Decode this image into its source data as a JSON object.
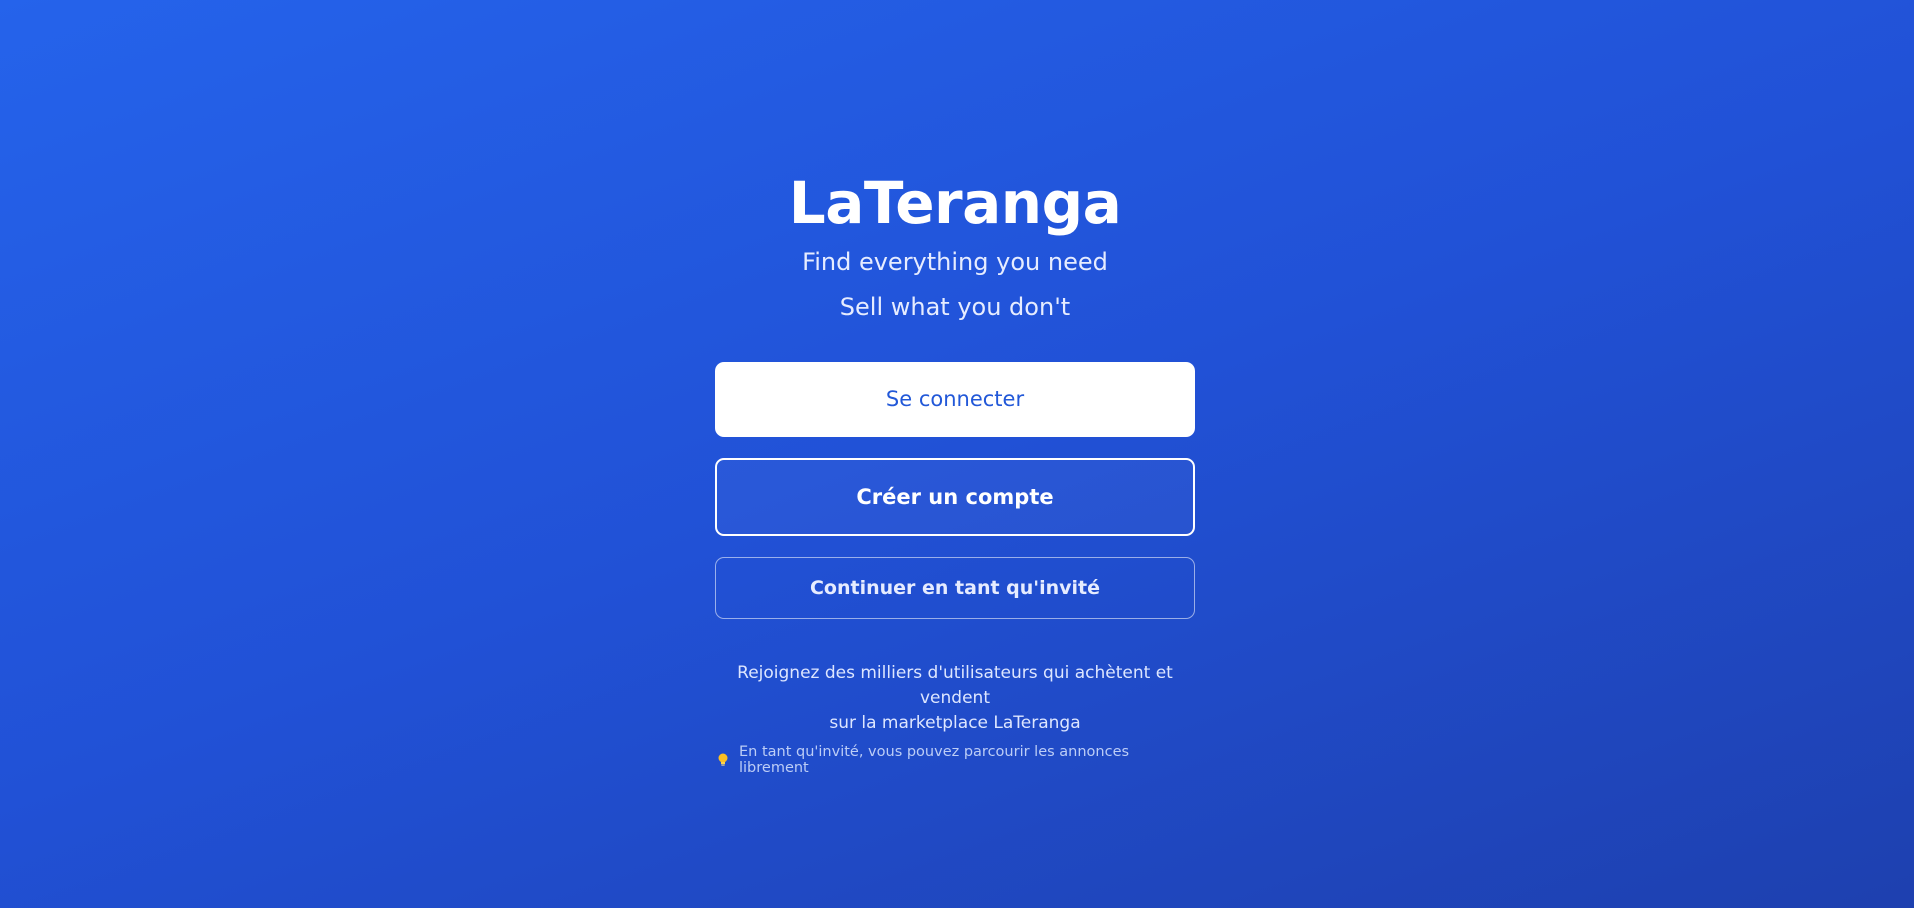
{
  "brand": {
    "title": "LaTeranga",
    "tagline_line1": "Find everything you need",
    "tagline_line2": "Sell what you don't"
  },
  "actions": {
    "login_label": "Se connecter",
    "signup_label": "Créer un compte",
    "guest_label": "Continuer en tant qu'invité"
  },
  "footer": {
    "info_line1": "Rejoignez des milliers d'utilisateurs qui achètent et vendent",
    "info_line2": "sur la marketplace LaTeranga",
    "hint_icon": "lightbulb-icon",
    "hint_text": "En tant qu'invité, vous pouvez parcourir les annonces librement"
  },
  "colors": {
    "background_start": "#2563eb",
    "background_end": "#1e40af",
    "primary_button_bg": "#ffffff",
    "primary_button_text": "#2258d8"
  }
}
